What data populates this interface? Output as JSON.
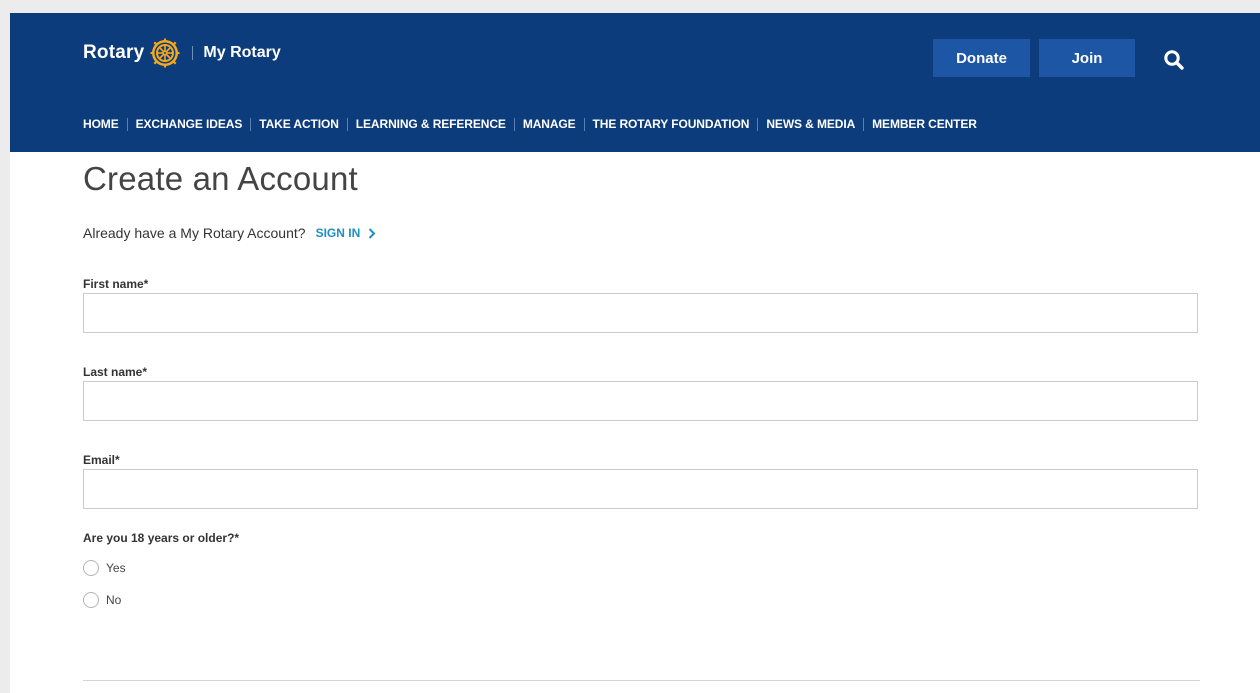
{
  "header": {
    "logo_text": "Rotary",
    "site_name": "My Rotary",
    "donate_label": "Donate",
    "join_label": "Join",
    "search_icon": "search-icon",
    "colors": {
      "header_bg": "#0c3c7c",
      "button_bg": "#1d56a5",
      "logo_wheel": "#f7a81b"
    }
  },
  "nav": {
    "items": [
      {
        "label": "HOME"
      },
      {
        "label": "EXCHANGE IDEAS"
      },
      {
        "label": "TAKE ACTION"
      },
      {
        "label": "LEARNING & REFERENCE"
      },
      {
        "label": "MANAGE"
      },
      {
        "label": "THE ROTARY FOUNDATION"
      },
      {
        "label": "NEWS & MEDIA"
      },
      {
        "label": "MEMBER CENTER"
      }
    ]
  },
  "main": {
    "title": "Create an Account",
    "already_text": "Already have a My Rotary Account?",
    "signin_label": "SIGN IN",
    "signin_color": "#1e8fc2",
    "fields": {
      "first_name_label": "First name*",
      "first_name_value": "",
      "last_name_label": "Last name*",
      "last_name_value": "",
      "email_label": "Email*",
      "email_value": ""
    },
    "age_question": "Are you 18 years or older?*",
    "age_options": [
      {
        "label": "Yes",
        "selected": false
      },
      {
        "label": "No",
        "selected": false
      }
    ]
  }
}
